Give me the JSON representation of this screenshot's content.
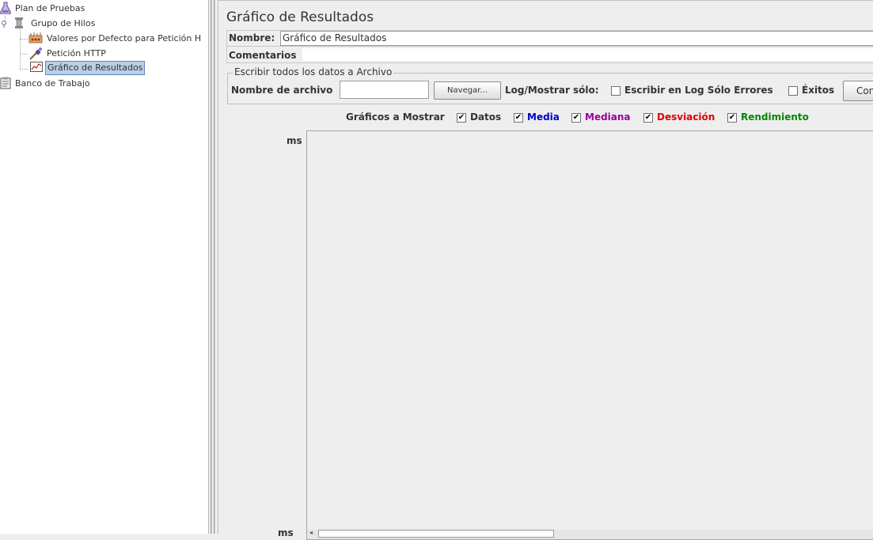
{
  "tree": {
    "items": [
      {
        "label": "Plan de Pruebas",
        "icon": "test-plan-flask-icon"
      },
      {
        "label": "Grupo de Hilos",
        "icon": "thread-group-spool-icon"
      },
      {
        "label": "Valores por Defecto para Petición H",
        "icon": "config-defaults-icon"
      },
      {
        "label": "Petición HTTP",
        "icon": "http-sampler-pipette-icon"
      },
      {
        "label": "Gráfico de Resultados",
        "icon": "graph-results-icon",
        "selected": true
      },
      {
        "label": "Banco de Trabajo",
        "icon": "workbench-clipboard-icon"
      }
    ]
  },
  "panel": {
    "title": "Gráfico de Resultados",
    "name_label": "Nombre:",
    "name_value": "Gráfico de Resultados",
    "comments_label": "Comentarios",
    "file_group_title": "Escribir todos los datos a Archivo",
    "file_name_label": "Nombre de archivo",
    "browse_button": "Navegar...",
    "log_show_label": "Log/Mostrar sólo:",
    "errors_only_label": "Escribir en Log Sólo Errores",
    "successes_label": "Éxitos",
    "configure_button": "Con"
  },
  "graphs": {
    "label": "Gráficos a Mostrar",
    "options": [
      {
        "label": "Datos",
        "checked": true,
        "color": "#000000"
      },
      {
        "label": "Media",
        "checked": true,
        "color": "#0000cc"
      },
      {
        "label": "Mediana",
        "checked": true,
        "color": "#990099"
      },
      {
        "label": "Desviación",
        "checked": true,
        "color": "#e00000"
      },
      {
        "label": "Rendimiento",
        "checked": true,
        "color": "#008800"
      }
    ],
    "y_unit_top": "ms",
    "y_unit_bottom": "ms"
  }
}
